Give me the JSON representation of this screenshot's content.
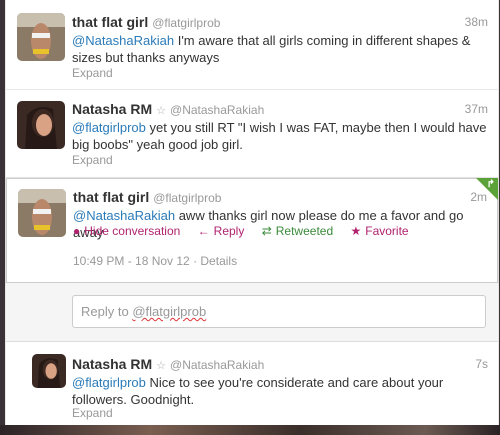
{
  "tweets": [
    {
      "fullname": "that flat girl",
      "username": "@flatgirlprob",
      "time": "38m",
      "mention": "@NatashaRakiah",
      "text": " I'm aware that all girls coming in different shapes & sizes but thanks anyways",
      "expand": "Expand"
    },
    {
      "fullname": "Natasha RM",
      "username": "@NatashaRakiah",
      "time": "37m",
      "mention": "@flatgirlprob",
      "text": " yet you still RT \"I wish I was FAT, maybe then I would have big boobs\" yeah good job girl.",
      "expand": "Expand"
    },
    {
      "fullname": "that flat girl",
      "username": "@flatgirlprob",
      "time": "2m",
      "mention": "@NatashaRakiah",
      "text": " aww thanks girl now please do me a favor and go away",
      "actions": {
        "hide": "Hide conversation",
        "reply": "Reply",
        "retweeted": "Retweeted",
        "favorite": "Favorite"
      },
      "meta": "10:49 PM - 18 Nov 12 · Details"
    },
    {
      "fullname": "Natasha RM",
      "username": "@NatashaRakiah",
      "time": "7s",
      "mention": "@flatgirlprob",
      "text": " Nice to see you're considerate and care about your followers. Goodnight.",
      "expand": "Expand"
    }
  ],
  "reply": {
    "prefix": "Reply to ",
    "handle": "@flatgirlprob"
  },
  "colors": {
    "link": "#2b7bb9",
    "action": "#b0236f",
    "retweeted": "#3a8a3a",
    "corner": "#5ba338"
  }
}
